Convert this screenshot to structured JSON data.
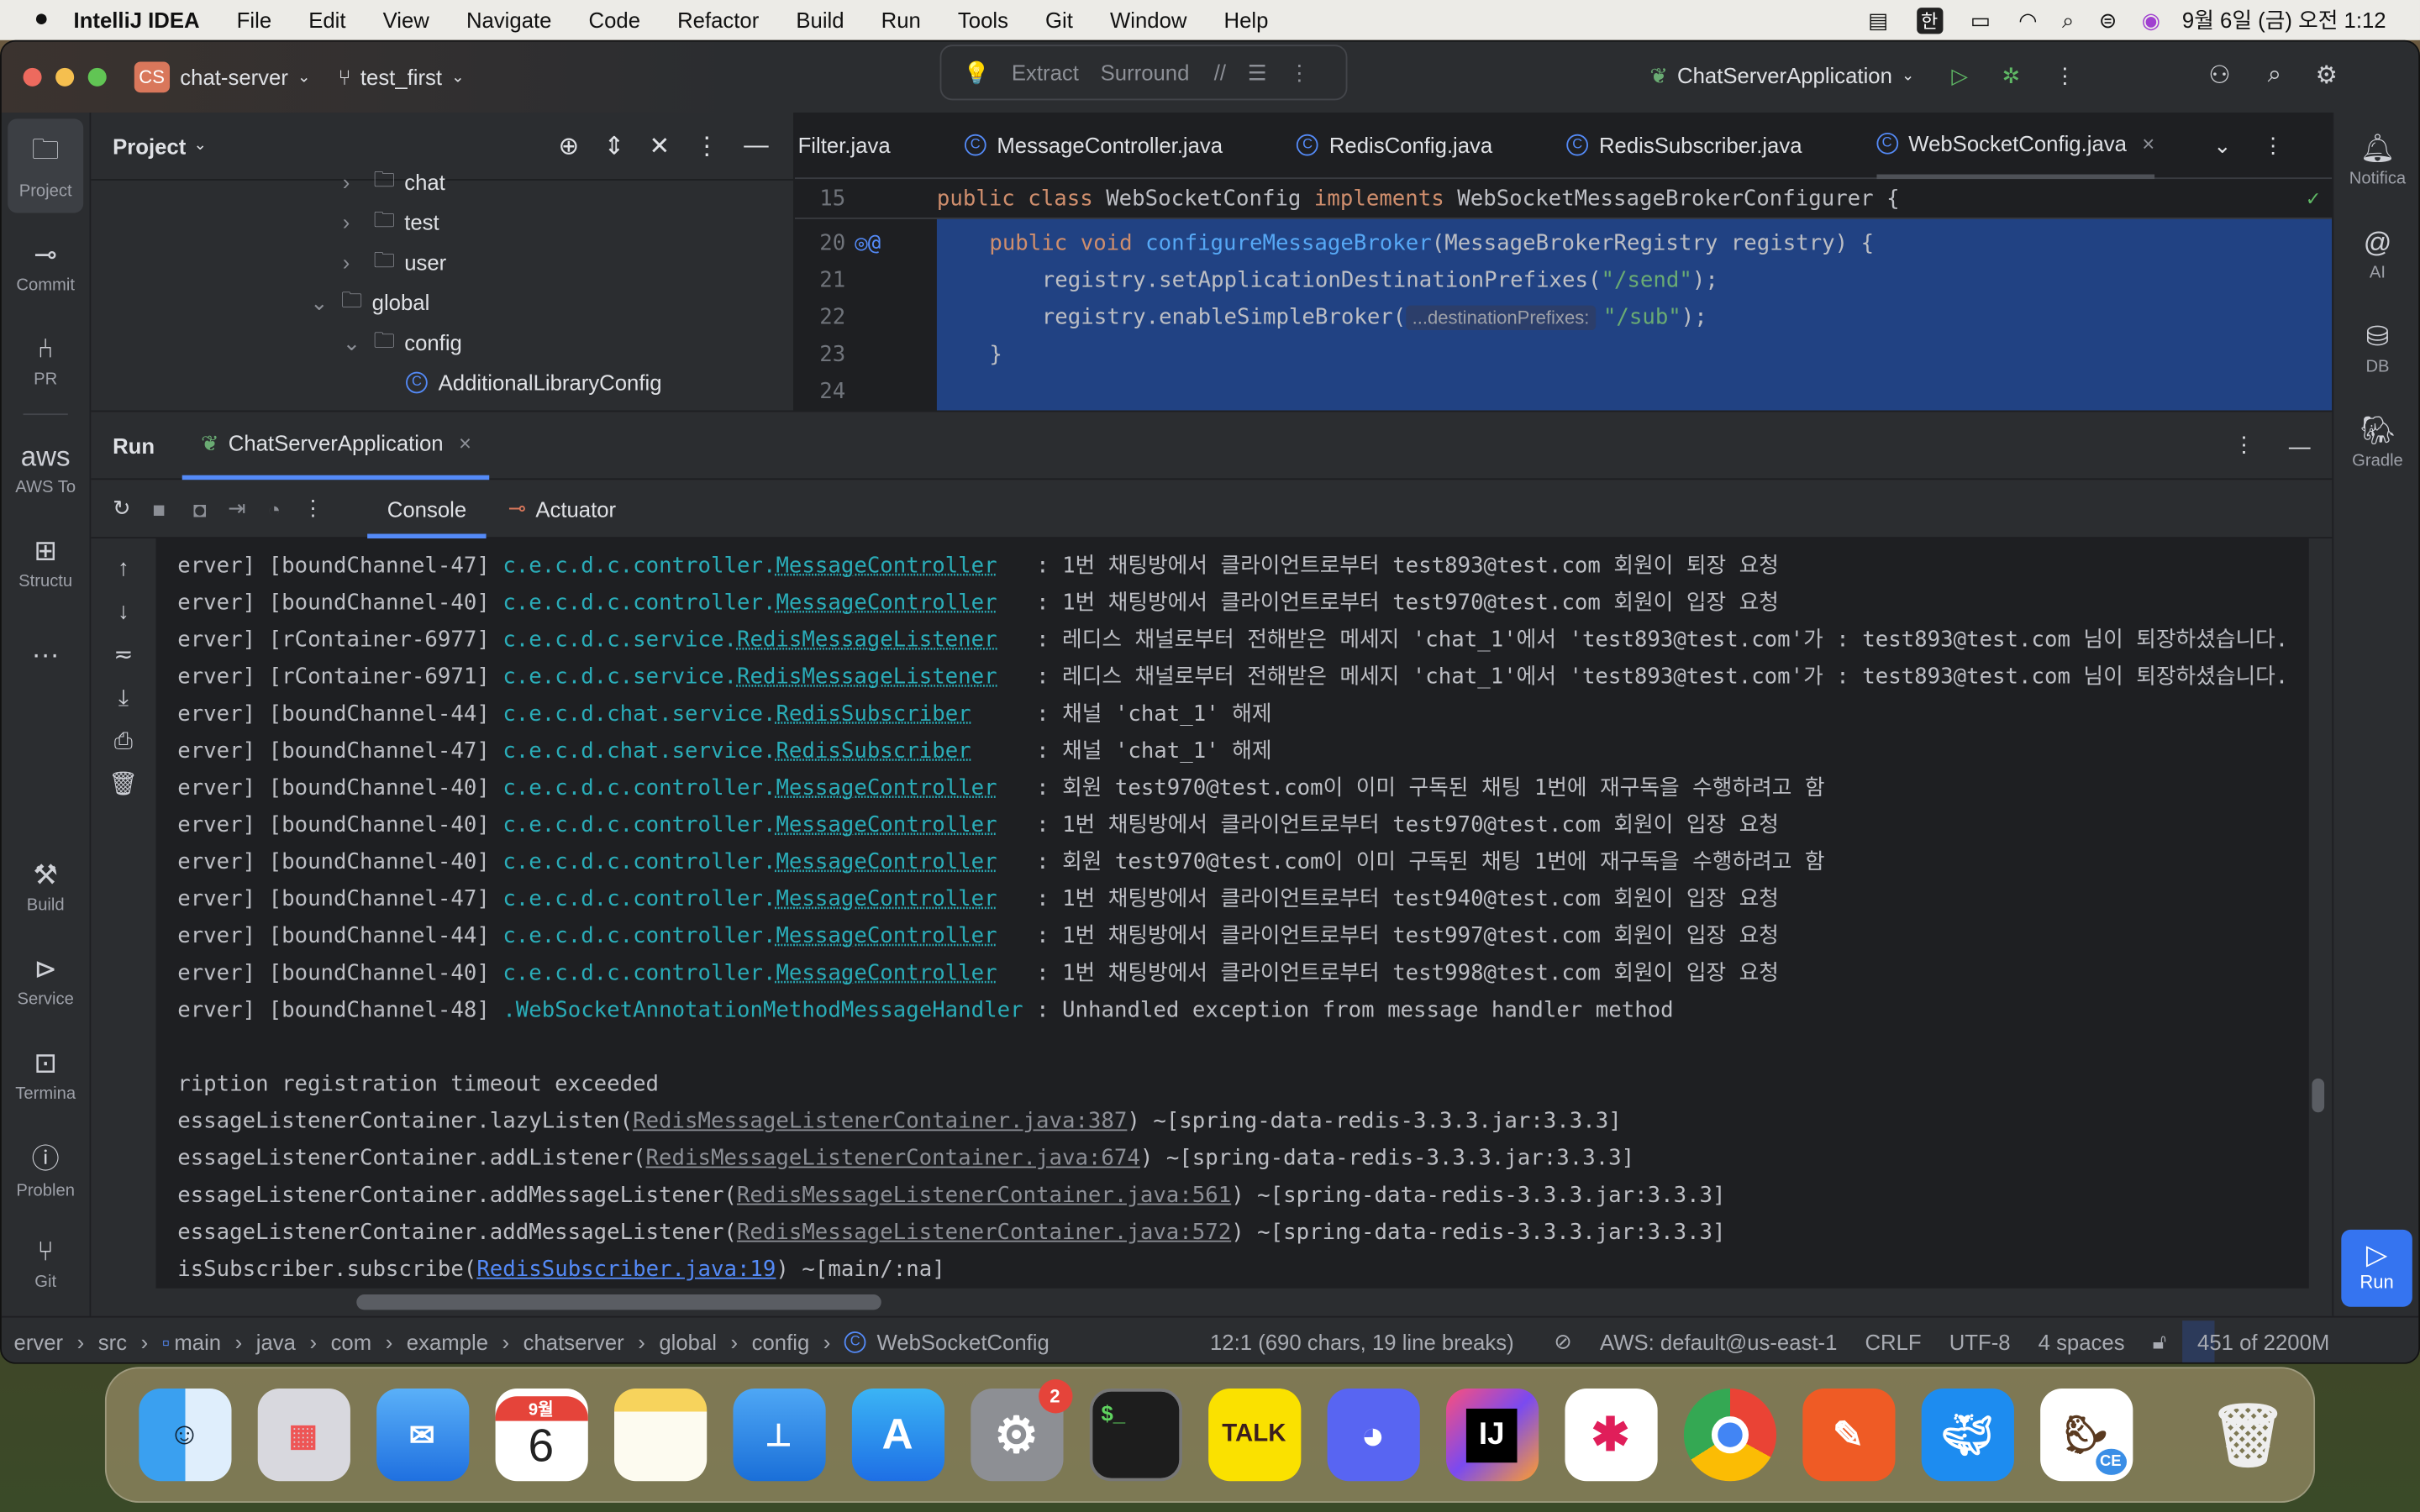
{
  "menubar": {
    "app": "IntelliJ IDEA",
    "items": [
      "File",
      "Edit",
      "View",
      "Navigate",
      "Code",
      "Refactor",
      "Build",
      "Run",
      "Tools",
      "Git",
      "Window",
      "Help"
    ],
    "ime": "한",
    "clock": "9월 6일 (금) 오전 1:12"
  },
  "titlebar": {
    "project_badge": "CS",
    "project": "chat-server",
    "branch": "test_first",
    "quick": [
      "Extract",
      "Surround"
    ],
    "run_config": "ChatServerApplication"
  },
  "left_strip": [
    "Project",
    "Commit",
    "PR",
    "AWS To",
    "Structu",
    "Build",
    "Service",
    "Termina",
    "Problen",
    "Git"
  ],
  "right_strip": [
    "Notifica",
    "AI",
    "DB",
    "Gradle"
  ],
  "project_panel": {
    "title": "Project",
    "tree": [
      {
        "label": "chat",
        "depth": 3,
        "arrow": "›"
      },
      {
        "label": "test",
        "depth": 3,
        "arrow": "›"
      },
      {
        "label": "user",
        "depth": 3,
        "arrow": "›"
      },
      {
        "label": "global",
        "depth": 2,
        "arrow": "⌄"
      },
      {
        "label": "config",
        "depth": 3,
        "arrow": "⌄"
      },
      {
        "label": "AdditionalLibraryConfig",
        "depth": 4,
        "arrow": "",
        "cls": true
      }
    ]
  },
  "editor": {
    "tabs": [
      "Filter.java",
      "MessageController.java",
      "RedisConfig.java",
      "RedisSubscriber.java",
      "WebSocketConfig.java"
    ],
    "active_tab": 4,
    "sticky": {
      "num": "15",
      "kw1": "public class",
      "name": "WebSocketConfig",
      "kw2": "implements",
      "rest": "WebSocketMessageBrokerConfigurer {"
    },
    "lines": [
      {
        "num": "20"
      },
      {
        "num": "21"
      },
      {
        "num": "22"
      },
      {
        "num": "23"
      },
      {
        "num": "24"
      }
    ],
    "code": {
      "l20_kw": "public void",
      "l20_fn": "configureMessageBroker",
      "l20_rest": "(MessageBrokerRegistry registry) {",
      "l21_a": "registry.setApplicationDestinationPrefixes(",
      "l21_s": "\"/send\"",
      "l21_b": ");",
      "l22_a": "registry.enableSimpleBroker(",
      "l22_hint": "...destinationPrefixes:",
      "l22_s": "\"/sub\"",
      "l22_b": ");",
      "l23": "}"
    }
  },
  "run": {
    "title": "Run",
    "tab": "ChatServerApplication",
    "subtabs": [
      "Console",
      "Actuator"
    ],
    "logs": [
      {
        "p": "erver]",
        "t": "[boundChannel-47]",
        "pkg": "c.e.c.d.c.controller.",
        "cls": "MessageController",
        "pad": "   ",
        "msg": ": 1번 채팅방에서 클라이언트로부터 test893@test.com 회원이 퇴장 요청"
      },
      {
        "p": "erver]",
        "t": "[boundChannel-40]",
        "pkg": "c.e.c.d.c.controller.",
        "cls": "MessageController",
        "pad": "   ",
        "msg": ": 1번 채팅방에서 클라이언트로부터 test970@test.com 회원이 입장 요청"
      },
      {
        "p": "erver]",
        "t": "[rContainer-6977]",
        "pkg": "c.e.c.d.c.service.",
        "cls": "RedisMessageListener",
        "pad": "   ",
        "msg": ": 레디스 채널로부터 전해받은 메세지 'chat_1'에서 'test893@test.com'가 : test893@test.com 님이 퇴장하셨습니다."
      },
      {
        "p": "erver]",
        "t": "[rContainer-6971]",
        "pkg": "c.e.c.d.c.service.",
        "cls": "RedisMessageListener",
        "pad": "   ",
        "msg": ": 레디스 채널로부터 전해받은 메세지 'chat_1'에서 'test893@test.com'가 : test893@test.com 님이 퇴장하셨습니다."
      },
      {
        "p": "erver]",
        "t": "[boundChannel-44]",
        "pkg": "c.e.c.d.chat.service.",
        "cls": "RedisSubscriber",
        "pad": "     ",
        "msg": ": 채널 'chat_1' 해제"
      },
      {
        "p": "erver]",
        "t": "[boundChannel-47]",
        "pkg": "c.e.c.d.chat.service.",
        "cls": "RedisSubscriber",
        "pad": "     ",
        "msg": ": 채널 'chat_1' 해제"
      },
      {
        "p": "erver]",
        "t": "[boundChannel-40]",
        "pkg": "c.e.c.d.c.controller.",
        "cls": "MessageController",
        "pad": "   ",
        "msg": ": 회원 test970@test.com이 이미 구독된 채팅 1번에 재구독을 수행하려고 함"
      },
      {
        "p": "erver]",
        "t": "[boundChannel-40]",
        "pkg": "c.e.c.d.c.controller.",
        "cls": "MessageController",
        "pad": "   ",
        "msg": ": 1번 채팅방에서 클라이언트로부터 test970@test.com 회원이 입장 요청"
      },
      {
        "p": "erver]",
        "t": "[boundChannel-40]",
        "pkg": "c.e.c.d.c.controller.",
        "cls": "MessageController",
        "pad": "   ",
        "msg": ": 회원 test970@test.com이 이미 구독된 채팅 1번에 재구독을 수행하려고 함"
      },
      {
        "p": "erver]",
        "t": "[boundChannel-47]",
        "pkg": "c.e.c.d.c.controller.",
        "cls": "MessageController",
        "pad": "   ",
        "msg": ": 1번 채팅방에서 클라이언트로부터 test940@test.com 회원이 입장 요청"
      },
      {
        "p": "erver]",
        "t": "[boundChannel-44]",
        "pkg": "c.e.c.d.c.controller.",
        "cls": "MessageController",
        "pad": "   ",
        "msg": ": 1번 채팅방에서 클라이언트로부터 test997@test.com 회원이 입장 요청"
      },
      {
        "p": "erver]",
        "t": "[boundChannel-40]",
        "pkg": "c.e.c.d.c.controller.",
        "cls": "MessageController",
        "pad": "   ",
        "msg": ": 1번 채팅방에서 클라이언트로부터 test998@test.com 회원이 입장 요청"
      },
      {
        "p": "erver]",
        "t": "[boundChannel-48]",
        "pkg": ".WebSocketAnnotationMethodMessageHandler",
        "cls": "",
        "pad": " ",
        "msg": ": Unhandled exception from message handler method"
      }
    ],
    "exception": "ription registration timeout exceeded",
    "stack": [
      {
        "a": "essageListenerContainer.lazyListen(",
        "link": "RedisMessageListenerContainer.java:387",
        "b": ") ~[spring-data-redis-3.3.3.jar:3.3.3]"
      },
      {
        "a": "essageListenerContainer.addListener(",
        "link": "RedisMessageListenerContainer.java:674",
        "b": ") ~[spring-data-redis-3.3.3.jar:3.3.3]"
      },
      {
        "a": "essageListenerContainer.addMessageListener(",
        "link": "RedisMessageListenerContainer.java:561",
        "b": ") ~[spring-data-redis-3.3.3.jar:3.3.3]"
      },
      {
        "a": "essageListenerContainer.addMessageListener(",
        "link": "RedisMessageListenerContainer.java:572",
        "b": ") ~[spring-data-redis-3.3.3.jar:3.3.3]"
      },
      {
        "a": "isSubscriber.subscribe(",
        "link": "RedisSubscriber.java:19",
        "b": ") ~[main/:na]",
        "blue": true
      }
    ],
    "run_button": "Run"
  },
  "statusbar": {
    "crumbs": [
      "erver",
      "src",
      "main",
      "java",
      "com",
      "example",
      "chatserver",
      "global",
      "config",
      "WebSocketConfig"
    ],
    "position": "12:1 (690 chars, 19 line breaks)",
    "aws": "AWS: default@us-east-1",
    "eol": "CRLF",
    "encoding": "UTF-8",
    "indent": "4 spaces",
    "memory": "451 of 2200M"
  },
  "dock": {
    "calendar_month": "9월",
    "calendar_day": "6",
    "settings_badge": "2",
    "kakao": "TALK",
    "intellij": "IJ",
    "dbeaver": "CE",
    "apps": [
      "finder",
      "launchpad",
      "mail",
      "calendar",
      "notes",
      "keynote",
      "app-store",
      "system-settings",
      "terminal",
      "kakaotalk",
      "discord",
      "intellij-idea",
      "slack",
      "chrome",
      "postman",
      "docker",
      "dbeaver",
      "trash"
    ]
  },
  "colors": {
    "accent": "#548af7",
    "logger": "#2aacb8",
    "keyword": "#cf8e6d",
    "string": "#6aab73",
    "selection": "#214283"
  }
}
